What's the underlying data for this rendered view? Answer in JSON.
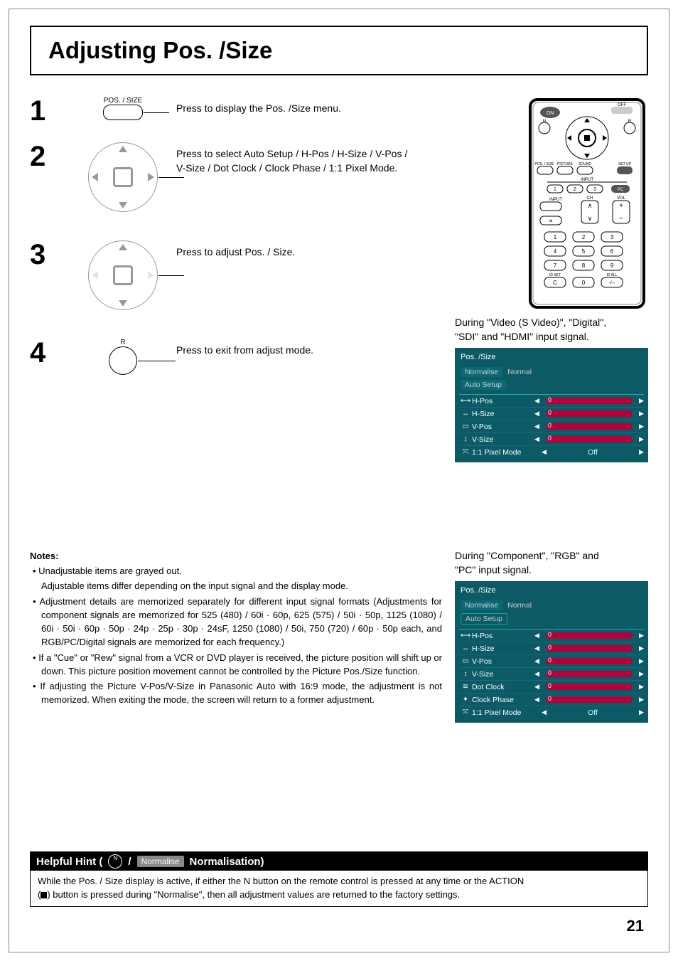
{
  "title": "Adjusting Pos. /Size",
  "steps": {
    "s1": {
      "num": "1",
      "iconLabel": "POS. / SIZE",
      "text": "Press to display the Pos. /Size menu."
    },
    "s2": {
      "num": "2",
      "text1": "Press to select Auto Setup / H-Pos / H-Size / V-Pos /",
      "text2": "V-Size / Dot Clock / Clock Phase / 1:1 Pixel Mode."
    },
    "s3": {
      "num": "3",
      "text": "Press to adjust Pos. / Size."
    },
    "s4": {
      "num": "4",
      "iconLabel": "R",
      "text": "Press to exit from adjust mode."
    }
  },
  "remote": {
    "on": "ON",
    "off": "OFF",
    "n": "N",
    "r": "R",
    "possize": "POS. / SIZE",
    "inputLabel": "INPUT",
    "inputBtn": "INPUT",
    "pc": "PC",
    "setup": "SET UP",
    "sound": "SOUND",
    "picture": "PICTURE",
    "ch": "CH",
    "vol": "VOL",
    "ok": "✕",
    "rowA": [
      "1",
      "2",
      "3"
    ],
    "rowB": [
      "4",
      "5",
      "6"
    ],
    "rowC": [
      "7",
      "8",
      "9"
    ],
    "idset": "ID SET",
    "idall": "ID ALL",
    "rowD": [
      "C",
      "0",
      "-/--"
    ]
  },
  "osdA": {
    "caption1": "During \"Video (S Video)\", \"Digital\",",
    "caption2": "\"SDI\" and \"HDMI\" input signal.",
    "title": "Pos. /Size",
    "normalise": "Normalise",
    "normal": "Normal",
    "auto": "Auto Setup",
    "rows": [
      {
        "icon": "⟷",
        "name": "H-Pos",
        "val": "0"
      },
      {
        "icon": "↔",
        "name": "H-Size",
        "val": "0"
      },
      {
        "icon": "▭",
        "name": "V-Pos",
        "val": "0"
      },
      {
        "icon": "↕",
        "name": "V-Size",
        "val": "0"
      }
    ],
    "pixel": {
      "icon": "⤧",
      "name": "1:1 Pixel Mode",
      "val": "Off"
    }
  },
  "osdB": {
    "caption1": "During \"Component\", \"RGB\" and",
    "caption2": "\"PC\" input signal.",
    "title": "Pos. /Size",
    "normalise": "Normalise",
    "normal": "Normal",
    "auto": "Auto Setup",
    "rows": [
      {
        "icon": "⟷",
        "name": "H-Pos",
        "val": "0"
      },
      {
        "icon": "↔",
        "name": "H-Size",
        "val": "0"
      },
      {
        "icon": "▭",
        "name": "V-Pos",
        "val": "0"
      },
      {
        "icon": "↕",
        "name": "V-Size",
        "val": "0"
      },
      {
        "icon": "≋",
        "name": "Dot Clock",
        "val": "0"
      },
      {
        "icon": "✦",
        "name": "Clock Phase",
        "val": "0"
      }
    ],
    "pixel": {
      "icon": "⤧",
      "name": "1:1 Pixel Mode",
      "val": "Off"
    }
  },
  "notes": {
    "heading": "Notes:",
    "items": [
      "Unadjustable items are grayed out.",
      "Adjustable items differ depending on the input signal and the display mode.",
      "Adjustment details are memorized separately for different input signal formats (Adjustments for component signals are memorized for 525 (480) / 60i · 60p, 625 (575) / 50i · 50p, 1125 (1080) / 60i · 50i · 60p · 50p · 24p · 25p · 30p · 24sF, 1250 (1080) / 50i, 750 (720) / 60p · 50p each, and RGB/PC/Digital signals are memorized for each frequency.)",
      "If a \"Cue\" or \"Rew\" signal from a VCR or DVD player is received, the picture position will shift up or down. This picture position movement cannot be controlled by the Picture Pos./Size function.",
      "If adjusting the Picture V-Pos/V-Size in Panasonic Auto with 16:9 mode, the adjustment is not memorized. When exiting the mode, the screen will return to a former adjustment."
    ]
  },
  "hint": {
    "lead": "Helpful Hint (",
    "n": "N",
    "slash": " / ",
    "normchip": "Normalise",
    "tail": " Normalisation)",
    "body1": "While the Pos. / Size display is active, if either the N button on the remote control is pressed at any time or the ACTION",
    "body2": "(",
    "body3": ") button is pressed during \"Normalise\", then all adjustment values are returned to the factory settings."
  },
  "pageNumber": "21"
}
